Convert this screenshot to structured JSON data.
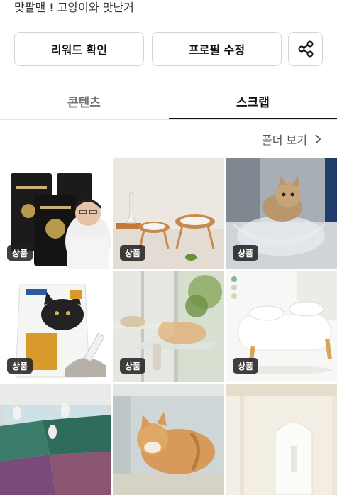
{
  "header": {
    "subtitle": "맞팔맨 ! 고양이와 맛난거"
  },
  "actions": {
    "reward_label": "리워드 확인",
    "profile_label": "프로필 수정",
    "share_icon": "share-icon"
  },
  "tabs": [
    {
      "label": "콘텐츠",
      "active": false
    },
    {
      "label": "스크랩",
      "active": true
    }
  ],
  "folder": {
    "label": "폴더 보기",
    "icon": "chevron-right-icon"
  },
  "grid": {
    "tiles": [
      {
        "tag": "상품",
        "kind": "cat-litter-bags-with-person"
      },
      {
        "tag": "상품",
        "kind": "wooden-bowl-stands"
      },
      {
        "tag": "상품",
        "kind": "cat-on-window-hammock"
      },
      {
        "tag": "상품",
        "kind": "cat-litter-pouch"
      },
      {
        "tag": "상품",
        "kind": "cats-on-window-shelf"
      },
      {
        "tag": "상품",
        "kind": "white-pet-bowl-stand"
      },
      {
        "tag": "",
        "kind": "cats-on-mats"
      },
      {
        "tag": "",
        "kind": "cat-lying-by-window"
      },
      {
        "tag": "",
        "kind": "white-room"
      }
    ]
  },
  "colors": {
    "active_tab": "#111111",
    "inactive_tab": "#777777",
    "tag_bg": "#2a2a2a"
  }
}
